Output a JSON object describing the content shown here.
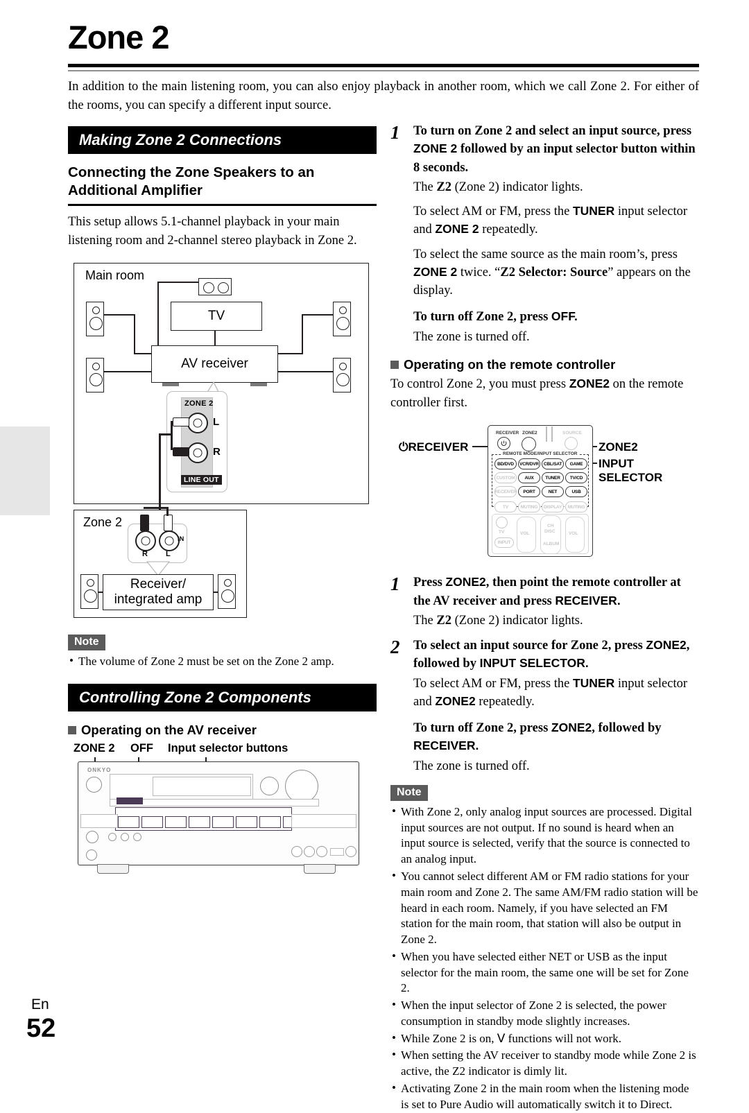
{
  "page": {
    "title": "Zone 2",
    "intro": "In addition to the main listening room, you can also enjoy playback in another room, which we call Zone 2. For either of the rooms, you can specify a different input source.",
    "footer_lang": "En",
    "footer_number": "52"
  },
  "left": {
    "section1_bar": "Making Zone 2 Connections",
    "subhead": "Connecting the Zone Speakers to an Additional Amplifier",
    "body": "This setup allows 5.1-channel playback in your main listening room and 2-channel stereo playback in Zone 2.",
    "diagram": {
      "main_room_label": "Main room",
      "tv_label": "TV",
      "av_receiver_label": "AV receiver",
      "zone2_jack_title": "ZONE 2",
      "jack_l": "L",
      "jack_r": "R",
      "line_out": "LINE OUT",
      "zone2_room_label": "Zone 2",
      "zone2_in": "IN",
      "zone2_in_r": "R",
      "zone2_in_l": "L",
      "amp_label": "Receiver/\ninteg amp",
      "amp_line1": "Receiver/",
      "amp_line2": "integrated amp"
    },
    "note_badge": "Note",
    "note_items": [
      "The volume of Zone 2 must be set on the Zone 2 amp."
    ],
    "section2_bar": "Controlling Zone 2 Components",
    "sqhead_av": "Operating on the AV receiver",
    "receiver_callouts": {
      "zone2": "ZONE 2",
      "off": "OFF",
      "input_selector_buttons": "Input selector buttons",
      "brand": "ONKYO"
    }
  },
  "right": {
    "step1": {
      "num": "1",
      "head_a": "To turn on Zone 2 and select an input source, press ",
      "head_zone2": "ZONE 2",
      "head_b": " followed by an input selector button within 8 seconds.",
      "p1_a": "The ",
      "p1_z2": "Z2",
      "p1_b": " (Zone 2) indicator lights.",
      "p2_a": "To select AM or FM, press the ",
      "p2_tuner": "TUNER",
      "p2_b": " input selector and ",
      "p2_zone2": "ZONE 2",
      "p2_c": " repeatedly.",
      "p3_a": "To select the same source as the main room’s, press ",
      "p3_zone2": "ZONE 2",
      "p3_b": " twice. “",
      "p3_quote": "Z2 Selector: Source",
      "p3_c": "” appears on the display.",
      "off_head_a": "To turn off Zone 2, press ",
      "off_head_b": "OFF.",
      "off_p": "The zone is turned off."
    },
    "sqhead_remote": "Operating on the remote controller",
    "remote_intro_a": "To control Zone 2, you must press ",
    "remote_intro_zone2": "ZONE2",
    "remote_intro_b": " on the remote controller first.",
    "remote": {
      "label_receiver": "RECEIVER",
      "label_zone2": "ZONE2",
      "label_input": "INPUT",
      "label_selector": "SELECTOR",
      "top_receiver": "RECEIVER",
      "top_zone2": "ZONE2",
      "top_source": "SOURCE",
      "mode_bar": "REMOTE MODE/INPUT SELECTOR",
      "buttons": [
        "BD/DVD",
        "VCR/DVR",
        "CBL/SAT",
        "GAME",
        "CUSTOM",
        "AUX",
        "TUNER",
        "TV/CD",
        "RECEIVER",
        "PORT",
        "NET",
        "USB",
        "TV",
        "MUTING",
        "DISPLAY",
        "MUTING"
      ],
      "bottom_tv": "TV",
      "bottom_input": "INPUT",
      "bottom_vol_l": "VOL",
      "bottom_vol_r": "VOL",
      "bottom_ch": "CH",
      "bottom_disc": "DISC",
      "bottom_album": "ALBUM"
    },
    "step2": {
      "num": "1",
      "head_a": "Press ",
      "head_zone2": "ZONE2",
      "head_b": ", then point the remote controller at the AV receiver and press ",
      "head_receiver": "RECEIVER.",
      "p1_a": "The ",
      "p1_z2": "Z2",
      "p1_b": " (Zone 2) indicator lights."
    },
    "step3": {
      "num": "2",
      "head_a": "To select an input source for Zone 2, press ",
      "head_zone2": "ZONE2",
      "head_b": ", followed by ",
      "head_input": "INPUT SELECTOR.",
      "p1_a": "To select AM or FM, press the ",
      "p1_tuner": "TUNER",
      "p1_b": " input selector and ",
      "p1_zone2": "ZONE2",
      "p1_c": " repeatedly.",
      "off_a": "To turn off Zone 2, press ",
      "off_zone2": "ZONE2",
      "off_b": ", followed by ",
      "off_receiver": "RECEIVER.",
      "off_p": "The zone is turned off."
    },
    "note_badge": "Note",
    "note_items": [
      "With Zone 2, only analog input sources are processed. Digital input sources are not output. If no sound is heard when an input source is selected, verify that the source is connected to an analog input.",
      "You cannot select different AM or FM radio stations for your main room and Zone 2. The same AM/FM radio station will be heard in each room. Namely, if you have selected an FM station for the main room, that station will also be output in Zone 2.",
      "When you have selected either NET or USB as the input selector for the main room, the same one will be set for Zone 2.",
      "When the input selector of Zone 2 is selected, the power consumption in standby mode slightly increases.",
      "While Zone 2 is on, Ⅴ functions will not work.",
      "When setting the AV receiver to standby mode while Zone 2 is active, the Z2 indicator is dimly lit.",
      "Activating Zone 2 in the main room when the listening mode is set to Pure Audio will automatically switch it to Direct."
    ]
  },
  "colors": {
    "bar_bg": "#000000",
    "note_badge_bg": "#5b5b5b",
    "edge_tab": "#e6e6e6",
    "line": "#231f20"
  }
}
